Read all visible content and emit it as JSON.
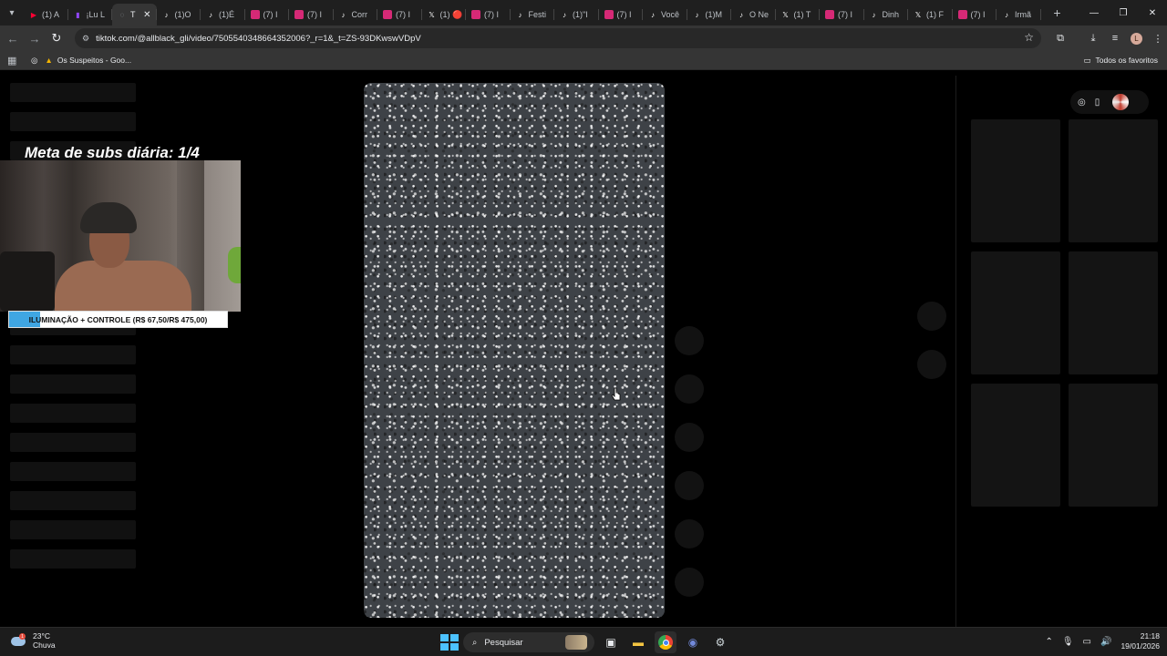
{
  "browser": {
    "tabs": [
      {
        "label": "(1) A",
        "icon": "youtube-icon",
        "color": "#ff0033"
      },
      {
        "label": "¡Lu L",
        "icon": "twitch-icon",
        "color": "#9146ff"
      },
      {
        "label": "T",
        "icon": "globe-icon",
        "color": "#9aa0a6",
        "active": true
      },
      {
        "label": "(1)O",
        "icon": "tiktok-icon",
        "color": "#ffffff"
      },
      {
        "label": "(1)É",
        "icon": "tiktok-icon",
        "color": "#ffffff"
      },
      {
        "label": "(7) I",
        "icon": "instagram-icon",
        "color": "#d62976"
      },
      {
        "label": "(7) I",
        "icon": "instagram-icon",
        "color": "#d62976"
      },
      {
        "label": "Corr",
        "icon": "tiktok-icon",
        "color": "#ffffff"
      },
      {
        "label": "(7) I",
        "icon": "instagram-icon",
        "color": "#d62976"
      },
      {
        "label": "(1) 🔴",
        "icon": "x-icon",
        "color": "#ffffff"
      },
      {
        "label": "(7) I",
        "icon": "instagram-icon",
        "color": "#d62976"
      },
      {
        "label": "Festi",
        "icon": "tiktok-icon",
        "color": "#ffffff"
      },
      {
        "label": "(1)\"I",
        "icon": "tiktok-icon",
        "color": "#ffffff"
      },
      {
        "label": "(7) I",
        "icon": "instagram-icon",
        "color": "#d62976"
      },
      {
        "label": "Você",
        "icon": "tiktok-icon",
        "color": "#ffffff"
      },
      {
        "label": "(1)M",
        "icon": "tiktok-icon",
        "color": "#ffffff"
      },
      {
        "label": "O Ne",
        "icon": "tiktok-icon",
        "color": "#ffffff"
      },
      {
        "label": "(1) T",
        "icon": "x-icon",
        "color": "#ffffff"
      },
      {
        "label": "(7) I",
        "icon": "instagram-icon",
        "color": "#d62976"
      },
      {
        "label": "Dinh",
        "icon": "tiktok-icon",
        "color": "#ffffff"
      },
      {
        "label": "(1) F",
        "icon": "x-icon",
        "color": "#ffffff"
      },
      {
        "label": "(7) I",
        "icon": "instagram-icon",
        "color": "#d62976"
      },
      {
        "label": "Irmã",
        "icon": "tiktok-icon",
        "color": "#ffffff"
      }
    ],
    "new_tab": "+",
    "url": "tiktok.com/@allblack_gli/video/7505540348664352006?_r=1&_t=ZS-93DKwswVDpV",
    "profile_initial": "L",
    "bookmarks": {
      "item": "Os Suspeitos - Goo...",
      "all": "Todos os favoritos"
    }
  },
  "stream_overlay": {
    "meta_text": "Meta de subs diária: 1/4",
    "progress_text": "ILUMINAÇÃO + CONTROLE (R$ 67,50/R$ 475,00)",
    "progress_value": 0.142,
    "progress_color": "#3fa6e3"
  },
  "taskbar": {
    "weather_temp": "23°C",
    "weather_desc": "Chuva",
    "search_placeholder": "Pesquisar",
    "time": "21:18",
    "date": "19/01/2026"
  }
}
